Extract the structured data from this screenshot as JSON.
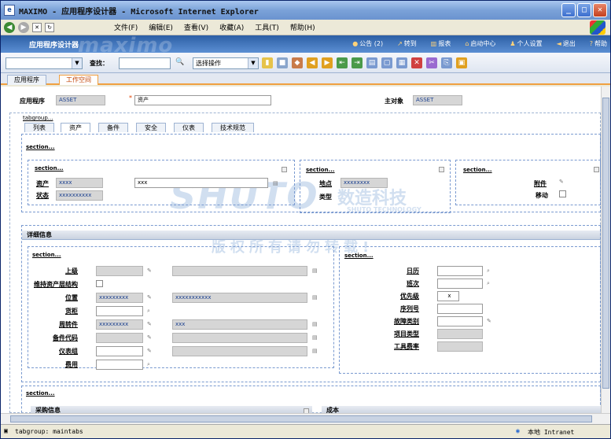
{
  "window": {
    "title": "MAXIMO - 应用程序设计器 - Microsoft Internet Explorer",
    "app_icon": "ie-icon",
    "buttons": [
      "_",
      "□",
      "X"
    ]
  },
  "menubar": {
    "items": [
      "文件(F)",
      "编辑(E)",
      "查看(V)",
      "收藏(A)",
      "工具(T)",
      "帮助(H)"
    ]
  },
  "maximo_header": {
    "app_title": "应用程序设计器",
    "logo": "maximo",
    "links": [
      "公告 (2)",
      "转到",
      "报表",
      "启动中心",
      "个人设置",
      "退出",
      "帮助"
    ]
  },
  "toolbar": {
    "find_label": "查找：",
    "find_value": "",
    "action_select": "选择操作",
    "first_select": ""
  },
  "app_tabs": [
    "应用程序",
    "工作空间"
  ],
  "header_fields": {
    "app_label": "应用程序",
    "app_value": "ASSET",
    "desc_value": "资产",
    "main_obj_label": "主对象",
    "main_obj_value": "ASSET"
  },
  "tabgroup_label": "tabgroup...",
  "sub_tabs": [
    "列表",
    "资产",
    "备件",
    "安全",
    "仪表",
    "技术规范"
  ],
  "section_label": "section...",
  "top_section_a": {
    "fields": [
      {
        "label": "资产",
        "value": "xxxx",
        "desc": "xxx"
      },
      {
        "label": "状态",
        "value": "xxxxxxxxxx"
      }
    ]
  },
  "top_section_b": {
    "fields": [
      {
        "label": "地点",
        "value": "xxxxxxxx"
      },
      {
        "label": "类型",
        "value": ""
      }
    ]
  },
  "top_section_c": {
    "fields": [
      {
        "label": "附件"
      },
      {
        "label": "移动"
      }
    ]
  },
  "details": {
    "title": "详细信息",
    "left_fields": [
      {
        "label": "上级",
        "value": "",
        "desc": ""
      },
      {
        "label": "维持资产层结构",
        "value": ""
      },
      {
        "label": "位置",
        "value": "xxxxxxxxx",
        "desc": "xxxxxxxxxxx"
      },
      {
        "label": "货柜",
        "value": ""
      },
      {
        "label": "周转件",
        "value": "xxxxxxxxx",
        "desc": "xxx"
      },
      {
        "label": "备件代码",
        "value": "",
        "desc": ""
      },
      {
        "label": "仪表组",
        "value": "",
        "desc": ""
      },
      {
        "label": "费用",
        "value": ""
      }
    ],
    "right_fields": [
      {
        "label": "日历",
        "value": ""
      },
      {
        "label": "班次",
        "value": ""
      },
      {
        "label": "优先级",
        "value": "x"
      },
      {
        "label": "序列号",
        "value": ""
      },
      {
        "label": "故障类别",
        "value": ""
      },
      {
        "label": "项目类型",
        "value": ""
      },
      {
        "label": "工具费率",
        "value": ""
      }
    ]
  },
  "bottom": {
    "left_title": "采购信息",
    "right_title": "成本"
  },
  "watermark": {
    "brand": "SHUTO",
    "cn": "数造科技",
    "en": "SHUTO TECHNOLOGY",
    "notice": "版权所有请勿转载!"
  },
  "statusbar": {
    "left": "tabgroup: maintabs",
    "zone": "本地 Intranet"
  }
}
